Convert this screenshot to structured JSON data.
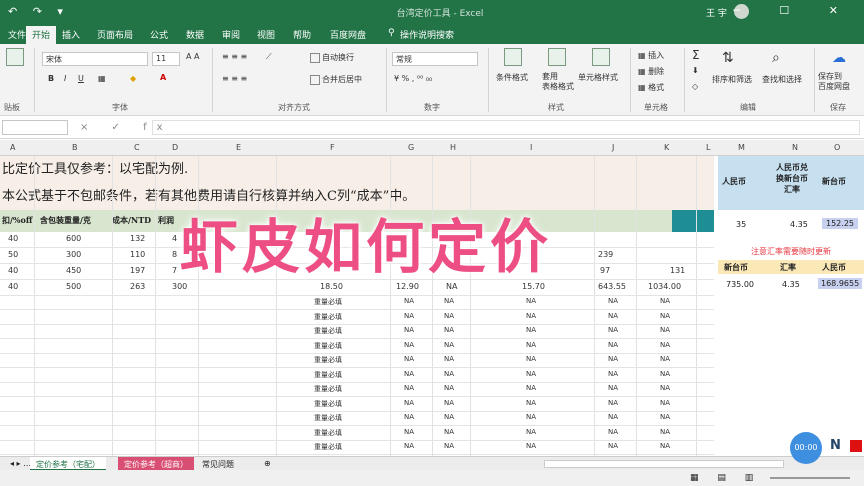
{
  "titlebar": {
    "quick_access": "↶ ↷ ▾",
    "doc_title": "台湾定价工具 - Excel",
    "user": "王 宇"
  },
  "tabs": [
    "文件",
    "开始",
    "插入",
    "页面布局",
    "公式",
    "数据",
    "审阅",
    "视图",
    "帮助",
    "百度网盘",
    "操作说明搜索"
  ],
  "ribbon": {
    "font_name": "宋体",
    "font_size": "11",
    "cell_style": "常规",
    "wrap_label": "自动换行",
    "merge_label": "合并后居中",
    "cond_format": "条件格式",
    "table_format": "套用\n表格格式",
    "cell_styles": "单元格样式",
    "insert": "插入",
    "delete": "删除",
    "format": "格式",
    "sort": "排序和筛选",
    "find": "查找和选择",
    "save_baidu": "保存到\n百度网盘",
    "group_labels": {
      "clipboard": "贴板",
      "font": "字体",
      "align": "对齐方式",
      "number": "数字",
      "styles": "样式",
      "cells": "单元格",
      "edit": "编辑",
      "save": "保存"
    }
  },
  "formulabar": {
    "fx": "× ✓ fx"
  },
  "columns": [
    "A",
    "B",
    "C",
    "D",
    "E",
    "F",
    "G",
    "H",
    "I",
    "J",
    "K",
    "L",
    "M",
    "N",
    "O"
  ],
  "notes": [
    "比定价工具仅参考：以宅配为例.",
    "本公式基于不包邮条件，若有其他费用请自行核算并纳入C列“成本”中。"
  ],
  "header_cells": [
    "扣/%off",
    "含包装重量/克",
    "成本/NTD",
    "利润"
  ],
  "rows": [
    [
      "40",
      "600",
      "132",
      "4"
    ],
    [
      "50",
      "300",
      "110",
      "8"
    ],
    [
      "40",
      "450",
      "197",
      "7"
    ],
    [
      "40",
      "500",
      "263",
      "300"
    ]
  ],
  "mid_cols": {
    "row3": [
      "18.50",
      "12.90",
      "NA",
      "15.70",
      "643.55",
      "1034.00"
    ],
    "row4_vals": [
      "239",
      "97",
      "131"
    ],
    "fill_text": "重量必填",
    "na": "NA"
  },
  "right_panel": {
    "h1": "人民币",
    "h2": "人民币兑换新台币汇率",
    "h3": "新台币",
    "v1": "35",
    "v2": "4.35",
    "v3": "152.25",
    "warning": "注意汇率需要随时更新",
    "h2b": [
      "新台币",
      "汇率",
      "人民币"
    ],
    "v2b": [
      "735.00",
      "4.35",
      "168.9655"
    ]
  },
  "overlay_text": "虾皮如何定价",
  "sheet_tabs": [
    "定价参考（宅配）",
    "定价参考（超商）",
    "常见问题"
  ],
  "float_timer": "00:00"
}
